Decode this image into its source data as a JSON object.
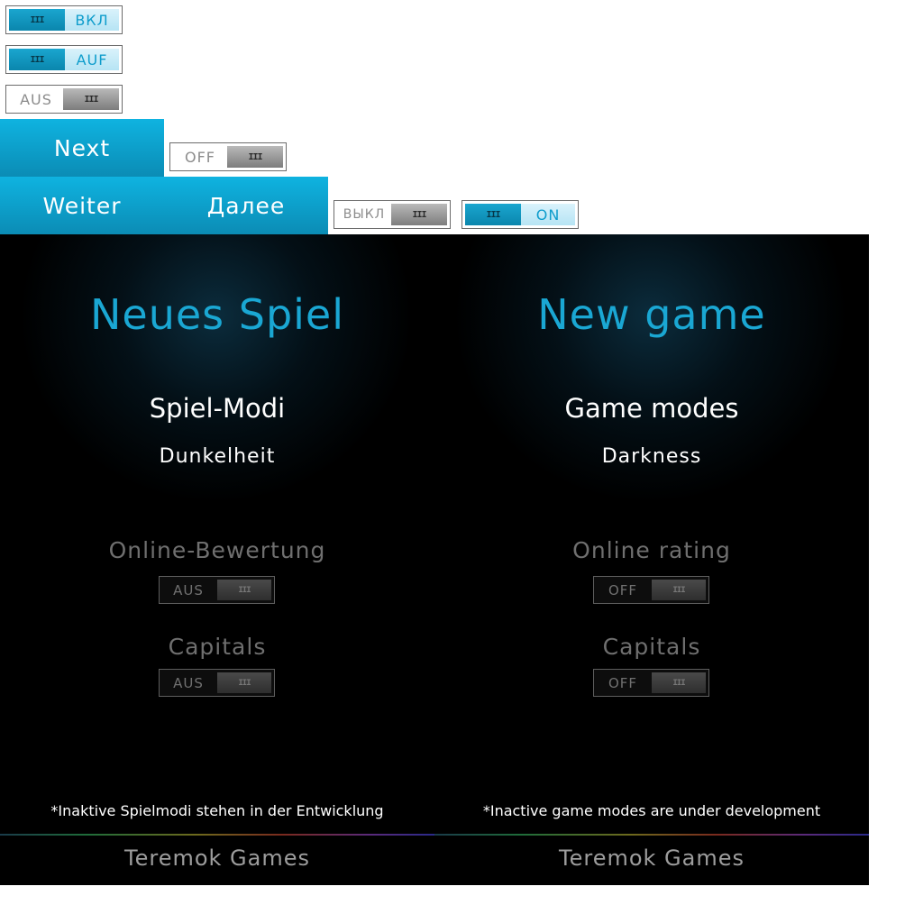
{
  "toggles": {
    "vkl": {
      "label": "ВКЛ",
      "state": "on"
    },
    "auf": {
      "label": "AUF",
      "state": "on"
    },
    "aus": {
      "label": "AUS",
      "state": "off"
    },
    "off": {
      "label": "OFF",
      "state": "off"
    },
    "vykl": {
      "label": "ВЫКЛ",
      "state": "off"
    },
    "on": {
      "label": "ON",
      "state": "on"
    }
  },
  "buttons": {
    "next": "Next",
    "weiter": "Weiter",
    "dalee": "Далее"
  },
  "panels": [
    {
      "title": "Neues Spiel",
      "modes_heading": "Spiel-Modi",
      "mode": "Dunkelheit",
      "option1": {
        "label": "Online-Bewertung",
        "toggle": "AUS"
      },
      "option2": {
        "label": "Capitals",
        "toggle": "AUS"
      },
      "note": "*Inaktive Spielmodi stehen in der Entwicklung",
      "brand": "Teremok Games"
    },
    {
      "title": "New game",
      "modes_heading": "Game modes",
      "mode": "Darkness",
      "option1": {
        "label": "Online rating",
        "toggle": "OFF"
      },
      "option2": {
        "label": "Capitals",
        "toggle": "OFF"
      },
      "note": "*Inactive game modes are under development",
      "brand": "Teremok Games"
    }
  ],
  "colors": {
    "accent": "#0fa7d6",
    "panel_bg": "#000000",
    "disabled_text": "#6f6f6f"
  }
}
